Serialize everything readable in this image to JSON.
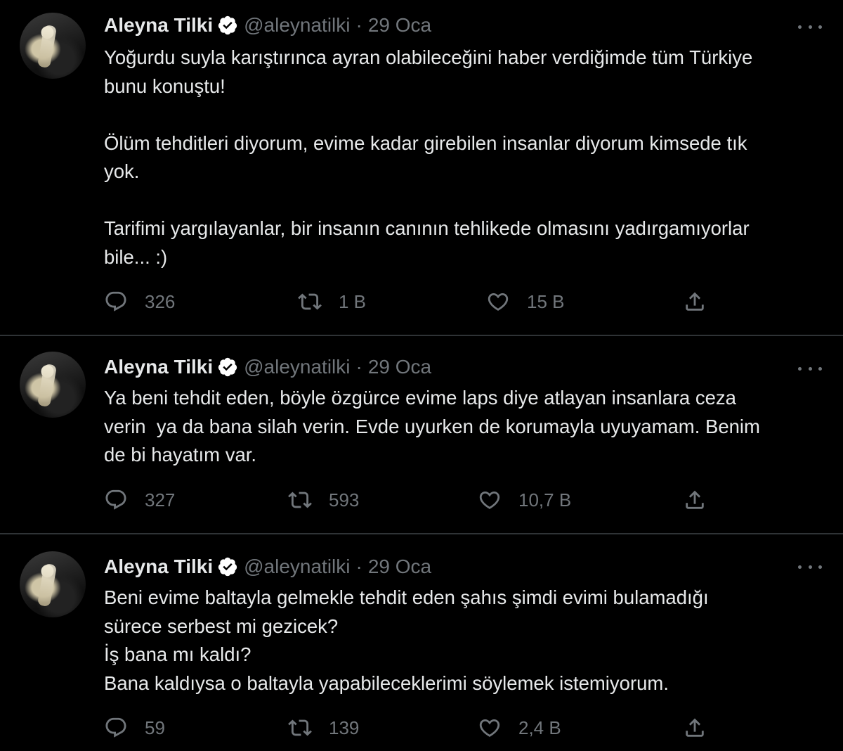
{
  "tweets": [
    {
      "author": "Aleyna Tilki",
      "handle": "@aleynatilki",
      "date": "29 Oca",
      "text": "Yoğurdu suyla karıştırınca ayran olabileceğini haber verdiğimde tüm Türkiye\nbunu konuştu!\n\nÖlüm tehditleri diyorum, evime kadar girebilen insanlar diyorum kimsede tık\nyok.\n\nTarifimi yargılayanlar, bir insanın canının tehlikede olmasını yadırgamıyorlar\nbile... :)",
      "replies": "326",
      "retweets": "1 B",
      "likes": "15 B"
    },
    {
      "author": "Aleyna Tilki",
      "handle": "@aleynatilki",
      "date": "29 Oca",
      "text": "Ya beni tehdit eden, böyle özgürce evime laps diye atlayan insanlara ceza\nverin  ya da bana silah verin. Evde uyurken de korumayla uyuyamam. Benim\nde bi hayatım var.",
      "replies": "327",
      "retweets": "593",
      "likes": "10,7 B"
    },
    {
      "author": "Aleyna Tilki",
      "handle": "@aleynatilki",
      "date": "29 Oca",
      "text": "Beni evime baltayla gelmekle tehdit eden şahıs şimdi evimi bulamadığı\nsürece serbest mi gezicek?\nİş bana mı kaldı?\nBana kaldıysa o baltayla yapabileceklerimi söylemek istemiyorum.",
      "replies": "59",
      "retweets": "139",
      "likes": "2,4 B"
    }
  ],
  "colors": {
    "background": "#000000",
    "text": "#e7e9ea",
    "muted": "#71767b",
    "verified": "#ffffff",
    "divider": "#2f3336"
  },
  "icons": [
    "reply-icon",
    "retweet-icon",
    "like-icon",
    "share-icon",
    "verified-badge-icon",
    "more-icon"
  ]
}
